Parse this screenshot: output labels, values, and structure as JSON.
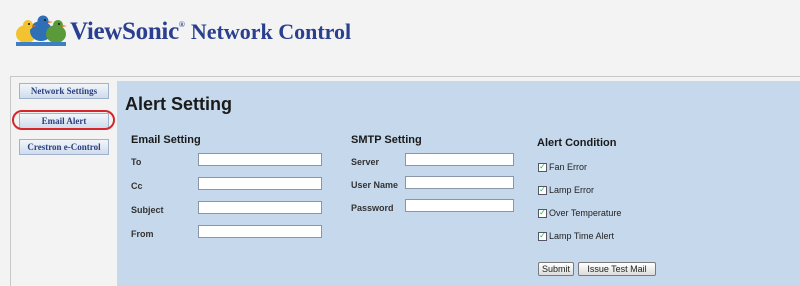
{
  "header": {
    "brand": "ViewSonic",
    "registered": "®",
    "product": "Network Control"
  },
  "sidebar": {
    "items": [
      {
        "label": "Network Settings"
      },
      {
        "label": "Email Alert"
      },
      {
        "label": "Crestron e-Control"
      }
    ],
    "highlighted": "Email Alert"
  },
  "main": {
    "title": "Alert Setting",
    "email_setting": {
      "heading": "Email Setting",
      "fields": [
        {
          "label": "To",
          "value": ""
        },
        {
          "label": "Cc",
          "value": ""
        },
        {
          "label": "Subject",
          "value": ""
        },
        {
          "label": "From",
          "value": ""
        }
      ]
    },
    "smtp_setting": {
      "heading": "SMTP Setting",
      "fields": [
        {
          "label": "Server",
          "value": ""
        },
        {
          "label": "User Name",
          "value": ""
        },
        {
          "label": "Password",
          "value": ""
        }
      ]
    },
    "alert_condition": {
      "heading": "Alert Condition",
      "options": [
        {
          "label": "Fan Error",
          "checked": true
        },
        {
          "label": "Lamp Error",
          "checked": true
        },
        {
          "label": "Over Temperature",
          "checked": true
        },
        {
          "label": "Lamp Time Alert",
          "checked": true
        }
      ]
    },
    "buttons": {
      "submit": "Submit",
      "test": "Issue Test Mail"
    }
  },
  "colors": {
    "brand": "#2a3f8f",
    "panel": "#c6d8ec",
    "highlight": "#d4262b"
  }
}
